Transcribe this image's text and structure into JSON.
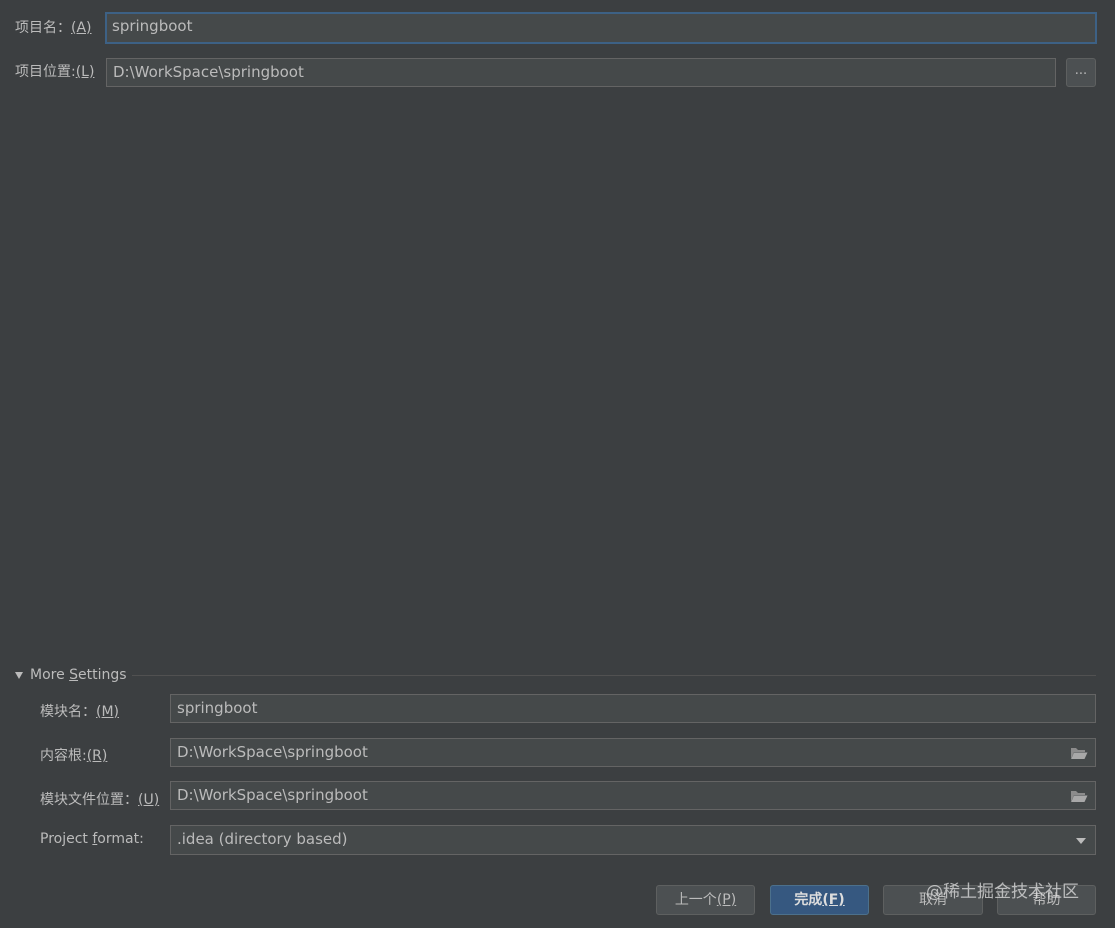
{
  "project": {
    "name_label": "项目名：",
    "name_mnemonic": "(A)",
    "name_value": "springboot",
    "location_label": "项目位置:",
    "location_mnemonic": "(L)",
    "location_value": "D:\\WorkSpace\\springboot",
    "browse_label": "..."
  },
  "more_settings": {
    "title_pre": "More ",
    "title_mn": "S",
    "title_post": "ettings",
    "expanded": true,
    "module_name_label": "模块名：",
    "module_name_mnemonic": "(M)",
    "module_name_value": "springboot",
    "content_root_label": "内容根:",
    "content_root_mnemonic": "(R)",
    "content_root_value": "D:\\WorkSpace\\springboot",
    "module_file_label": "模块文件位置：",
    "module_file_mnemonic": "(U)",
    "module_file_value": "D:\\WorkSpace\\springboot",
    "format_label_pre": "Project ",
    "format_label_mn": "f",
    "format_label_post": "ormat:",
    "format_value": ".idea (directory based)"
  },
  "buttons": {
    "previous_label": "上一个",
    "previous_mnemonic": "(P)",
    "finish_label": "完成",
    "finish_mnemonic": "(F)",
    "cancel_label": "取消",
    "help_label": "帮助"
  },
  "watermark": "@稀土掘金技术社区",
  "icons": {
    "browse": "folder-icon",
    "dropdown": "chevron-down-icon",
    "collapse": "triangle-down-icon"
  },
  "colors": {
    "background": "#3c3f41",
    "field_bg": "#45494a",
    "focus_border": "#3d6185",
    "default_button": "#365880"
  }
}
